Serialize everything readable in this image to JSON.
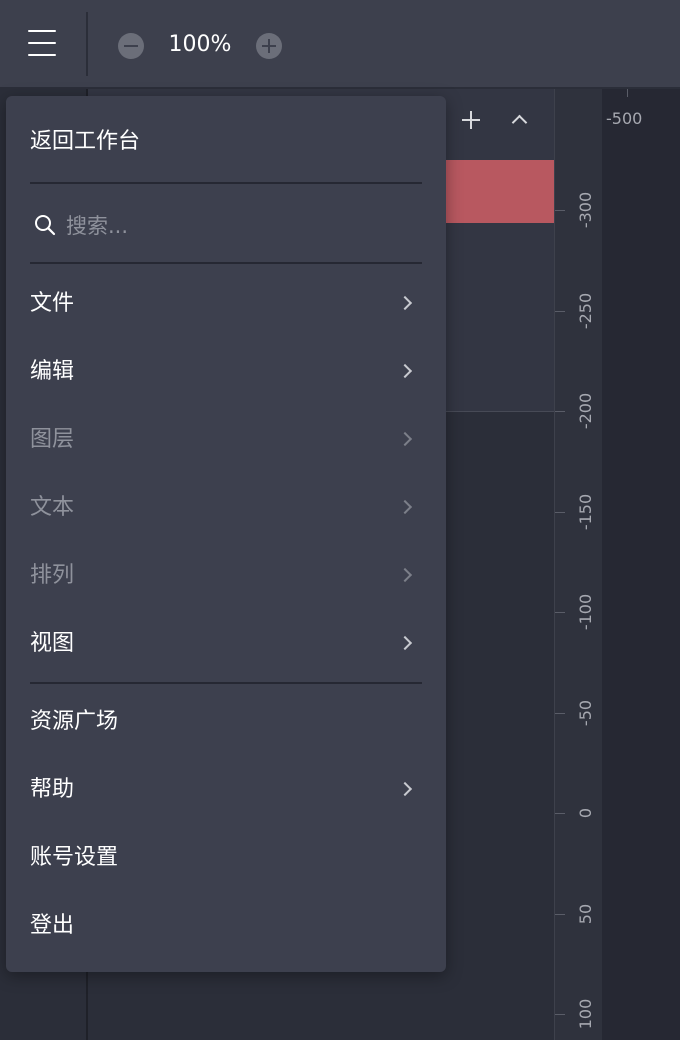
{
  "toolbar": {
    "zoom_level": "100%",
    "menu_icon": "hamburger-menu-icon",
    "zoom_out_icon": "minus-circle-icon",
    "zoom_in_icon": "plus-circle-icon"
  },
  "layers_panel": {
    "add_icon": "plus-icon",
    "collapse_icon": "chevron-up-icon",
    "selected_color": "#b85860"
  },
  "ruler": {
    "top_label": "-500",
    "labels": [
      "-300",
      "-250",
      "-200",
      "-150",
      "-100",
      "-50",
      "0",
      "50",
      "100"
    ]
  },
  "menu": {
    "back_label": "返回工作台",
    "search_placeholder": "搜索...",
    "search_icon": "search-icon",
    "items": [
      {
        "label": "文件",
        "disabled": false,
        "submenu": true
      },
      {
        "label": "编辑",
        "disabled": false,
        "submenu": true
      },
      {
        "label": "图层",
        "disabled": true,
        "submenu": true
      },
      {
        "label": "文本",
        "disabled": true,
        "submenu": true
      },
      {
        "label": "排列",
        "disabled": true,
        "submenu": true
      },
      {
        "label": "视图",
        "disabled": false,
        "submenu": true
      }
    ],
    "bottom_items": [
      {
        "label": "资源广场",
        "disabled": false,
        "submenu": false
      },
      {
        "label": "帮助",
        "disabled": false,
        "submenu": true
      },
      {
        "label": "账号设置",
        "disabled": false,
        "submenu": false
      },
      {
        "label": "登出",
        "disabled": false,
        "submenu": false
      }
    ]
  },
  "colors": {
    "toolbar_bg": "#3d404d",
    "menu_bg": "#3d404e",
    "canvas_bg": "#2b2e39",
    "accent_red": "#b85860"
  }
}
